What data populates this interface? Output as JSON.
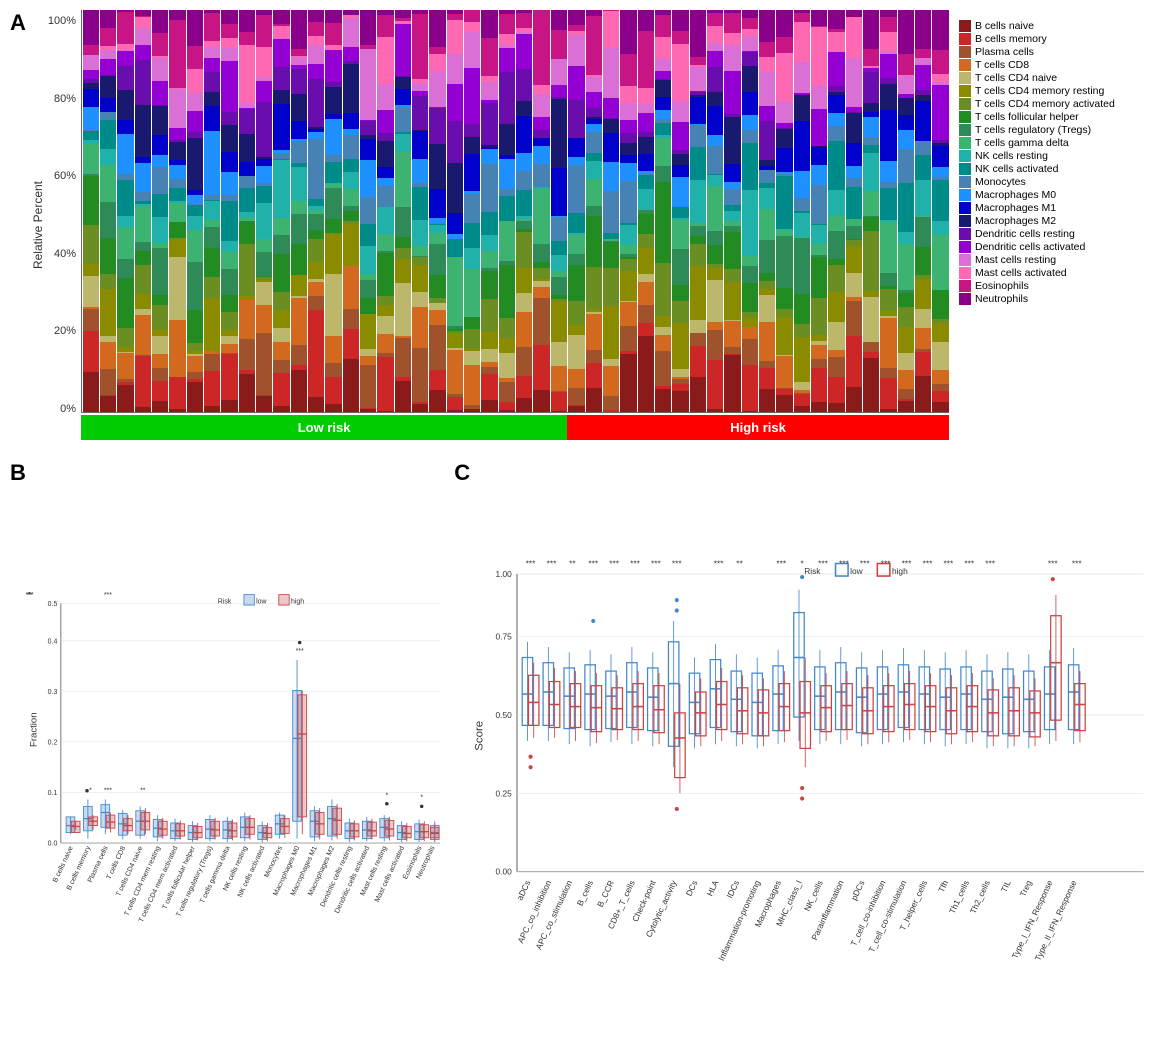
{
  "panelA": {
    "label": "A",
    "yAxisLabel": "Relative Percent",
    "yTicks": [
      "100%",
      "80%",
      "60%",
      "40%",
      "20%",
      "0%"
    ],
    "riskLow": "Low risk",
    "riskHigh": "High risk",
    "lowBars": 28,
    "highBars": 22,
    "legend": [
      {
        "label": "B cells naive",
        "color": "#8B1A1A"
      },
      {
        "label": "B cells memory",
        "color": "#CD2626"
      },
      {
        "label": "Plasma cells",
        "color": "#A0522D"
      },
      {
        "label": "T cells CD8",
        "color": "#D2691E"
      },
      {
        "label": "T cells CD4 naive",
        "color": "#BDB76B"
      },
      {
        "label": "T cells CD4 memory resting",
        "color": "#8B8B00"
      },
      {
        "label": "T cells CD4 memory activated",
        "color": "#6B8E23"
      },
      {
        "label": "T cells follicular helper",
        "color": "#228B22"
      },
      {
        "label": "T cells regulatory (Tregs)",
        "color": "#2E8B57"
      },
      {
        "label": "T cells gamma delta",
        "color": "#3CB371"
      },
      {
        "label": "NK cells resting",
        "color": "#20B2AA"
      },
      {
        "label": "NK cells activated",
        "color": "#008B8B"
      },
      {
        "label": "Monocytes",
        "color": "#4682B4"
      },
      {
        "label": "Macrophages M0",
        "color": "#1E90FF"
      },
      {
        "label": "Macrophages M1",
        "color": "#0000CD"
      },
      {
        "label": "Macrophages M2",
        "color": "#191970"
      },
      {
        "label": "Dendritic cells resting",
        "color": "#6A0DAD"
      },
      {
        "label": "Dendritic cells activated",
        "color": "#9400D3"
      },
      {
        "label": "Mast cells resting",
        "color": "#DA70D6"
      },
      {
        "label": "Mast cells activated",
        "color": "#FF69B4"
      },
      {
        "label": "Eosinophils",
        "color": "#C71585"
      },
      {
        "label": "Neutrophils",
        "color": "#8B008B"
      }
    ]
  },
  "panelB": {
    "label": "B",
    "yAxisLabel": "Fraction",
    "riskLegend": "Risk",
    "lowLabel": "low",
    "highLabel": "high",
    "xLabels": [
      "B cells naive",
      "B cells memory",
      "Plasma cells",
      "T cells CD8",
      "T cells CD4 naive",
      "T cells CD4 memory resting",
      "T cells CD4 memory activated",
      "T cells follicular helper",
      "T cells regulatory (Tregs)",
      "T cells gamma delta",
      "NK cells resting",
      "NK cells activated",
      "Monocytes",
      "Macrophages M0",
      "Macrophages M1",
      "Macrophages M2",
      "Dendritic cells resting",
      "Dendritic cells activated",
      "Mast cells resting",
      "Mast cells activated",
      "Eosinophils",
      "Neutrophils"
    ],
    "significance": [
      "",
      "*",
      "***",
      "",
      "",
      "**",
      "",
      "",
      "",
      "",
      "",
      "",
      "",
      "***",
      "",
      "",
      "",
      "",
      "*",
      "",
      "*",
      ""
    ]
  },
  "panelC": {
    "label": "C",
    "yAxisLabel": "Score",
    "riskLegend": "Risk",
    "lowLabel": "low",
    "highLabel": "high",
    "xLabels": [
      "aDCs",
      "APC_co_inhibition",
      "APC_co_stimulation",
      "B_cells",
      "B_CCR",
      "CD8+_T_cells",
      "Check-point",
      "Cytolytic_activity",
      "DCs",
      "HLA",
      "IDCs",
      "Inflammation-promoting",
      "Macrophages",
      "MHC_class_I",
      "NK_cells",
      "Parainflammation",
      "pDCs",
      "T_cell_co-inhibition",
      "T_cell_co-stimulation",
      "T_helper_cells",
      "Tfh",
      "Th1_cells",
      "Th2_cells",
      "TIL",
      "Treg",
      "Type_I_IFN_Response",
      "Type_II_IFN_Response"
    ],
    "significance": [
      "***",
      "***",
      "**",
      "***",
      "***",
      "***",
      "***",
      "***",
      "",
      "***",
      "**",
      "",
      "***",
      "*",
      "***",
      "***",
      "***",
      "***",
      "***",
      "***",
      "***",
      "***",
      "***",
      "",
      "",
      "***",
      "***"
    ]
  }
}
